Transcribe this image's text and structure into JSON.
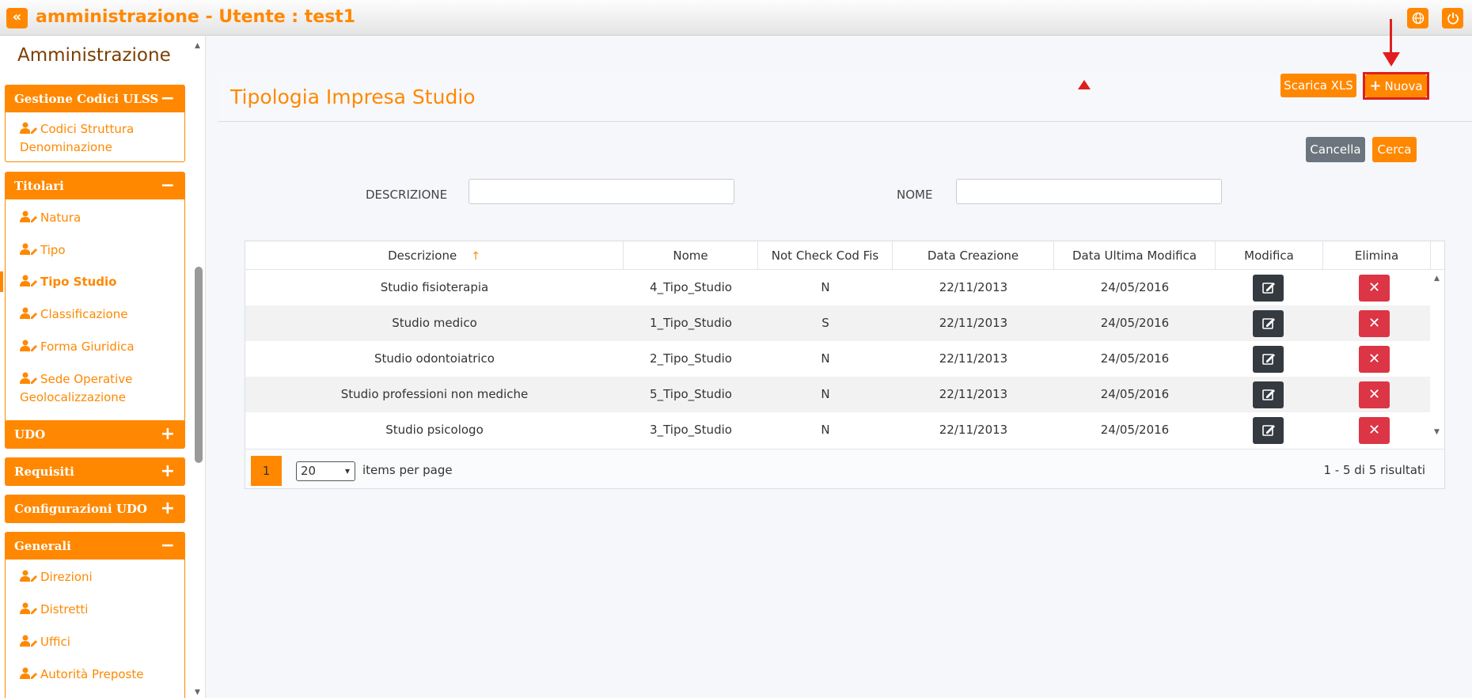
{
  "app": {
    "title": "amministrazione - Utente : test1"
  },
  "sidebar": {
    "heading": "Amministrazione",
    "groups": [
      {
        "label": "Gestione Codici ULSS",
        "sign": "−",
        "items": [
          {
            "label": "Codici Struttura Denominazione"
          }
        ]
      },
      {
        "label": "Titolari",
        "sign": "−",
        "items": [
          {
            "label": "Natura"
          },
          {
            "label": "Tipo"
          },
          {
            "label": "Tipo Studio"
          },
          {
            "label": "Classificazione"
          },
          {
            "label": "Forma Giuridica"
          },
          {
            "label": "Sede Operative Geolocalizzazione"
          }
        ]
      },
      {
        "label": "UDO",
        "sign": "+"
      },
      {
        "label": "Requisiti",
        "sign": "+"
      },
      {
        "label": "Configurazioni UDO",
        "sign": "+"
      },
      {
        "label": "Generali",
        "sign": "−",
        "items": [
          {
            "label": "Direzioni"
          },
          {
            "label": "Distretti"
          },
          {
            "label": "Uffici"
          },
          {
            "label": "Autorità Preposte"
          }
        ]
      }
    ]
  },
  "main": {
    "title": "Tipologia Impresa Studio",
    "download_label": "Scarica XLS",
    "new_label": "Nuova",
    "cancel_label": "Cancella",
    "search_label": "Cerca",
    "filters": [
      {
        "label": "DESCRIZIONE",
        "value": ""
      },
      {
        "label": "NOME",
        "value": ""
      }
    ]
  },
  "table": {
    "columns": [
      "Descrizione",
      "Nome",
      "Not Check Cod Fis",
      "Data Creazione",
      "Data Ultima Modifica",
      "Modifica",
      "Elimina"
    ],
    "rows": [
      [
        "Studio fisioterapia",
        "4_Tipo_Studio",
        "N",
        "22/11/2013",
        "24/05/2016"
      ],
      [
        "Studio medico",
        "1_Tipo_Studio",
        "S",
        "22/11/2013",
        "24/05/2016"
      ],
      [
        "Studio odontoiatrico",
        "2_Tipo_Studio",
        "N",
        "22/11/2013",
        "24/05/2016"
      ],
      [
        "Studio professioni non mediche",
        "5_Tipo_Studio",
        "N",
        "22/11/2013",
        "24/05/2016"
      ],
      [
        "Studio psicologo",
        "3_Tipo_Studio",
        "N",
        "22/11/2013",
        "24/05/2016"
      ]
    ]
  },
  "pager": {
    "page": "1",
    "per_page": "20",
    "per_page_label": "items per page",
    "info": "1 - 5 di 5 risultati"
  },
  "colors": {
    "accent": "#ff8800",
    "danger": "#dc3545",
    "dark": "#343a40",
    "secondary": "#6c757d"
  }
}
